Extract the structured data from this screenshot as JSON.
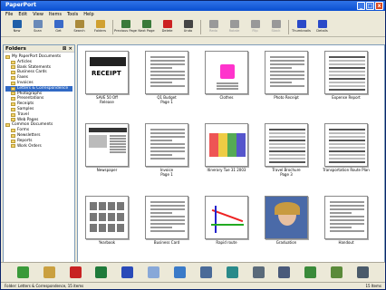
{
  "title": "PaperPort",
  "menu": [
    "File",
    "Edit",
    "View",
    "Items",
    "Tools",
    "Help"
  ],
  "toolbar": [
    {
      "label": "New",
      "color": "#1f5fa8"
    },
    {
      "label": "Scan",
      "color": "#6a8ab8"
    },
    {
      "label": "Get",
      "color": "#3a6ac8"
    },
    {
      "label": "Search",
      "color": "#aa8a3a"
    },
    {
      "label": "Folders",
      "color": "#d0a030"
    },
    {
      "label": "Previous Page",
      "color": "#3a7a3a"
    },
    {
      "label": "Next Page",
      "color": "#3a7a3a"
    },
    {
      "label": "Delete",
      "color": "#cc2222"
    },
    {
      "label": "Undo",
      "color": "#444"
    },
    {
      "label": "Redo",
      "color": "#999"
    },
    {
      "label": "Rotate",
      "color": "#999"
    },
    {
      "label": "Flip",
      "color": "#999"
    },
    {
      "label": "Stack",
      "color": "#999"
    },
    {
      "label": "Thumbnails",
      "color": "#2a4ac8"
    },
    {
      "label": "Details",
      "color": "#2a4ac8"
    }
  ],
  "folders": {
    "header": "Folders",
    "items": [
      {
        "label": "My PaperPort Documents",
        "level": 0,
        "selected": false
      },
      {
        "label": "Articles",
        "level": 1,
        "selected": false
      },
      {
        "label": "Bank Statements",
        "level": 1,
        "selected": false
      },
      {
        "label": "Business Cards",
        "level": 1,
        "selected": false
      },
      {
        "label": "Faxes",
        "level": 1,
        "selected": false
      },
      {
        "label": "Invoices",
        "level": 1,
        "selected": false
      },
      {
        "label": "Letters & Correspondence",
        "level": 1,
        "selected": true
      },
      {
        "label": "Photographs",
        "level": 1,
        "selected": false
      },
      {
        "label": "Presentations",
        "level": 1,
        "selected": false
      },
      {
        "label": "Receipts",
        "level": 1,
        "selected": false
      },
      {
        "label": "Samples",
        "level": 1,
        "selected": false
      },
      {
        "label": "Travel",
        "level": 1,
        "selected": false
      },
      {
        "label": "Web Pages",
        "level": 1,
        "selected": false
      },
      {
        "label": "Common Documents",
        "level": 0,
        "selected": false
      },
      {
        "label": "Forms",
        "level": 1,
        "selected": false
      },
      {
        "label": "Newsletters",
        "level": 1,
        "selected": false
      },
      {
        "label": "Reports",
        "level": 1,
        "selected": false
      },
      {
        "label": "Work Orders",
        "level": 1,
        "selected": false
      }
    ]
  },
  "thumbs": [
    {
      "caption": "SAVE 50 Off\nRelease",
      "type": "receipt"
    },
    {
      "caption": "Q1 Budget\nPage 1",
      "type": "doc"
    },
    {
      "caption": "Clothes",
      "type": "small"
    },
    {
      "caption": "Photo Receipt",
      "type": "doc"
    },
    {
      "caption": "Expense Report",
      "type": "table"
    },
    {
      "caption": "Newspaper",
      "type": "news"
    },
    {
      "caption": "Invoice\nPage 1",
      "type": "doc"
    },
    {
      "caption": "Itinerary Tue 31 2003",
      "type": "map"
    },
    {
      "caption": "Travel Brochure\nPage 3",
      "type": "grid"
    },
    {
      "caption": "Transportation Route Plan",
      "type": "table"
    },
    {
      "caption": "Yearbook",
      "type": "faces"
    },
    {
      "caption": "Business Card",
      "type": "doc"
    },
    {
      "caption": "Rapid route",
      "type": "subway"
    },
    {
      "caption": "Graduation",
      "type": "photo"
    },
    {
      "caption": "Handout",
      "type": "doc"
    }
  ],
  "bottom_icons": [
    {
      "name": "paperport-icon",
      "color": "#3a9a3a"
    },
    {
      "name": "paint-icon",
      "color": "#caa040"
    },
    {
      "name": "acrobat-icon",
      "color": "#c82222"
    },
    {
      "name": "excel-icon",
      "color": "#1f7a3a"
    },
    {
      "name": "word-icon",
      "color": "#2a4ab8"
    },
    {
      "name": "notepad-icon",
      "color": "#88a8d8"
    },
    {
      "name": "outlook-icon",
      "color": "#3a7ac8"
    },
    {
      "name": "satellite-icon",
      "color": "#4a6a98"
    },
    {
      "name": "globe-icon",
      "color": "#2a8a8a"
    },
    {
      "name": "fax-icon",
      "color": "#5a6a7a"
    },
    {
      "name": "printer-icon",
      "color": "#4a5a7a"
    },
    {
      "name": "recycle-icon",
      "color": "#3a8a3a"
    },
    {
      "name": "clipboard-icon",
      "color": "#5a8a3a"
    },
    {
      "name": "print-icon",
      "color": "#4a5a6a"
    }
  ],
  "status": {
    "left": "Folder: Letters & Correspondence, 15 items",
    "right": "15 Items"
  }
}
